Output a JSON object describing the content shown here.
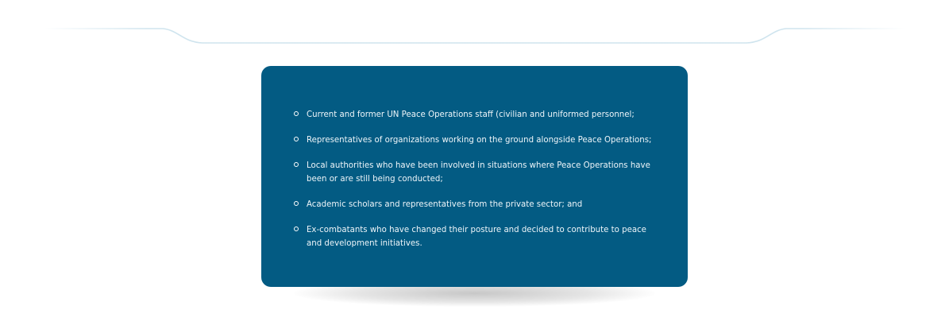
{
  "colors": {
    "card_background": "#035b83",
    "text": "#eef5f9",
    "decoration_line": "#cfe4ee"
  },
  "list": {
    "items": [
      {
        "text": "Current and former UN Peace Operations staff (civilian and uniformed personnel;"
      },
      {
        "text": "Representatives of organizations working on the ground alongside Peace Operations;"
      },
      {
        "text": "Local authorities who have been involved in situations where Peace Operations have been or are still being conducted;"
      },
      {
        "text": "Academic scholars and representatives from the private sector; and"
      },
      {
        "text": "Ex-combatants who have changed their posture and decided to contribute to peace and development initiatives."
      }
    ]
  }
}
